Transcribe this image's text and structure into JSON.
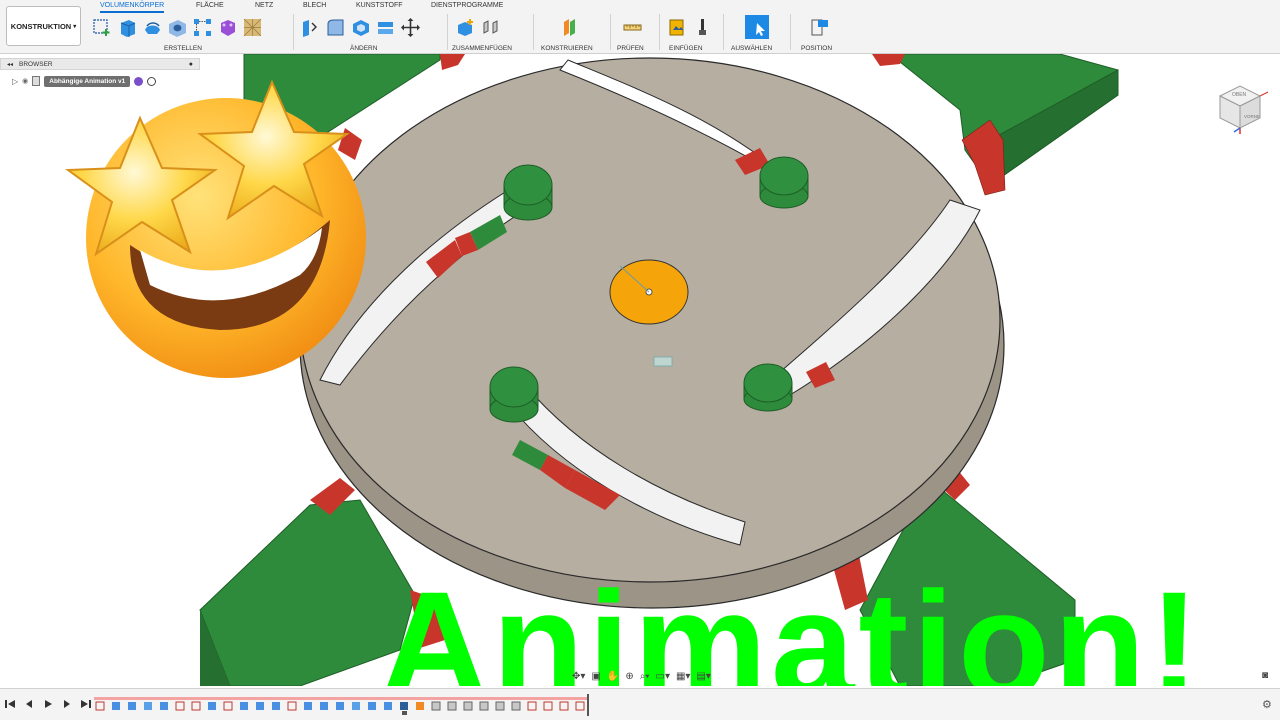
{
  "workspace": {
    "label": "KONSTRUKTION"
  },
  "tabs": [
    {
      "label": "VOLUMENKÖRPER",
      "active": true
    },
    {
      "label": "FLÄCHE"
    },
    {
      "label": "NETZ"
    },
    {
      "label": "BLECH"
    },
    {
      "label": "KUNSTSTOFF"
    },
    {
      "label": "DIENSTPROGRAMME"
    }
  ],
  "groups": {
    "erstellen": "ERSTELLEN",
    "aendern": "ÄNDERN",
    "zusammenfuegen": "ZUSAMMENFÜGEN",
    "konstruieren": "KONSTRUIEREN",
    "pruefen": "PRÜFEN",
    "einfuegen": "EINFÜGEN",
    "auswaehlen": "AUSWÄHLEN",
    "position": "POSITION"
  },
  "browser": {
    "title": "BROWSER",
    "document": "Abhängige Animation v1"
  },
  "viewcube": {
    "top_label": "OBEN",
    "front_label": "VORNE"
  },
  "overlay": {
    "text": "Animation!"
  },
  "colors": {
    "accent": "#0a6ed1",
    "overlay_text": "#00ff00",
    "disc": "#b6aea1",
    "green_part": "#2e8b3c",
    "red_part": "#c8352b",
    "origin": "#f5a50a"
  }
}
